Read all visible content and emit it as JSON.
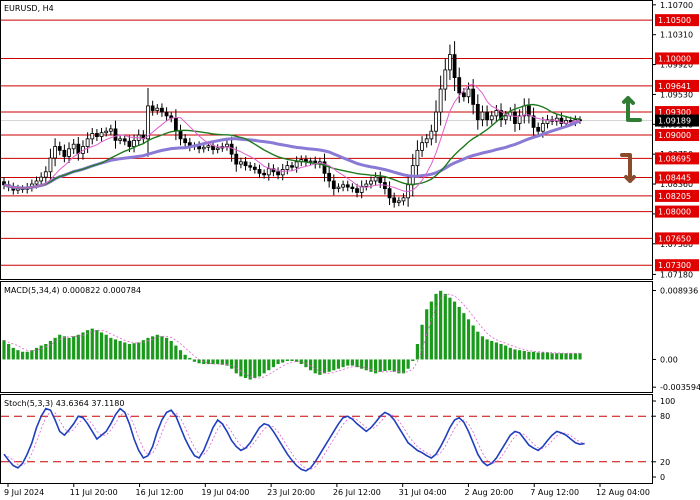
{
  "chart_data": [
    {
      "type": "candlestick",
      "title": "EURUSD, H4",
      "y_ticks": [
        "1.10700",
        "1.10310",
        "1.09920",
        "1.09530",
        "1.09140",
        "1.08750",
        "1.08360",
        "1.07970",
        "1.07580",
        "1.07180"
      ],
      "y_range": [
        1.0712,
        1.0735
      ],
      "x_tick_labels": [
        "9 Jul 2024",
        "11 Jul 20:00",
        "16 Jul 12:00",
        "19 Jul 04:00",
        "23 Jul 20:00",
        "26 Jul 12:00",
        "31 Jul 04:00",
        "2 Aug 20:00",
        "7 Aug 12:00",
        "12 Aug 04:00"
      ],
      "levels": [
        {
          "label": "1.10500",
          "value": 1.105
        },
        {
          "label": "1.10000",
          "value": 1.1
        },
        {
          "label": "1.09641",
          "value": 1.09641
        },
        {
          "label": "1.09300",
          "value": 1.093
        },
        {
          "label": "1.09000",
          "value": 1.09
        },
        {
          "label": "1.08695",
          "value": 1.08695
        },
        {
          "label": "1.08445",
          "value": 1.08445
        },
        {
          "label": "1.08205",
          "value": 1.08205
        },
        {
          "label": "1.08000",
          "value": 1.08
        },
        {
          "label": "1.07650",
          "value": 1.0765
        },
        {
          "label": "1.07300",
          "value": 1.073
        }
      ],
      "current_price": {
        "label": "1.09189",
        "value": 1.09189
      },
      "series_close": [
        1.0835,
        1.0832,
        1.0828,
        1.083,
        1.0829,
        1.0832,
        1.0836,
        1.084,
        1.0845,
        1.0852,
        1.087,
        1.0885,
        1.088,
        1.0872,
        1.0882,
        1.0888,
        1.0876,
        1.0885,
        1.0895,
        1.0902,
        1.0898,
        1.0903,
        1.0905,
        1.0908,
        1.0893,
        1.0895,
        1.0892,
        1.0885,
        1.0893,
        1.09,
        1.0895,
        1.0938,
        1.0932,
        1.0935,
        1.093,
        1.0925,
        1.0922,
        1.0905,
        1.0895,
        1.089,
        1.0885,
        1.0886,
        1.0882,
        1.0884,
        1.0886,
        1.0881,
        1.0883,
        1.0885,
        1.0888,
        1.0875,
        1.0862,
        1.0865,
        1.086,
        1.0858,
        1.0855,
        1.085,
        1.0848,
        1.0856,
        1.0852,
        1.0848,
        1.0855,
        1.086,
        1.0858,
        1.0865,
        1.0868,
        1.0865,
        1.0866,
        1.0862,
        1.0865,
        1.085,
        1.084,
        1.083,
        1.0832,
        1.0835,
        1.0832,
        1.083,
        1.0825,
        1.0833,
        1.0836,
        1.084,
        1.0845,
        1.0838,
        1.083,
        1.0818,
        1.0812,
        1.0814,
        1.0818,
        1.0835,
        1.086,
        1.088,
        1.089,
        1.0895,
        1.0905,
        1.093,
        1.096,
        1.0985,
        1.1005,
        1.0975,
        1.0955,
        1.095,
        1.096,
        1.094,
        1.092,
        1.093,
        1.092,
        1.0925,
        1.0932,
        1.092,
        1.0925,
        1.093,
        1.0915,
        1.0925,
        1.0938,
        1.0925,
        1.091,
        1.0905,
        1.0915,
        1.092,
        1.0918,
        1.0922,
        1.0915,
        1.0919,
        1.0917,
        1.092,
        1.0919
      ],
      "ma_fast_name": "MA (pink)",
      "ma_mid_name": "MA (green)",
      "ma_slow_name": "MA (purple)",
      "annotations": [
        "arrow-up (green)",
        "arrow-down (brown)"
      ]
    },
    {
      "type": "bar",
      "title": "MACD(5,34,4) 0.000822 0.000784",
      "y_ticks": [
        "0.008936",
        "0.00",
        "-0.003594"
      ],
      "y_range": [
        -0.003594,
        0.008936
      ],
      "hist_values": [
        0.0025,
        0.002,
        0.0015,
        0.0012,
        0.001,
        0.001,
        0.0012,
        0.0015,
        0.0018,
        0.002,
        0.0024,
        0.0028,
        0.0032,
        0.003,
        0.0028,
        0.003,
        0.0032,
        0.0035,
        0.0038,
        0.004,
        0.0038,
        0.0035,
        0.0032,
        0.0028,
        0.0026,
        0.0024,
        0.0022,
        0.002,
        0.0021,
        0.0022,
        0.0025,
        0.0028,
        0.003,
        0.0032,
        0.003,
        0.0028,
        0.0024,
        0.0018,
        0.0012,
        0.0006,
        0.0002,
        -0.0003,
        -0.0005,
        -0.0006,
        -0.0006,
        -0.0006,
        -0.0006,
        -0.0007,
        -0.0008,
        -0.0012,
        -0.0018,
        -0.0022,
        -0.0024,
        -0.0026,
        -0.0024,
        -0.0022,
        -0.0018,
        -0.0014,
        -0.001,
        -0.0006,
        -0.0004,
        -0.0002,
        -0.0002,
        -0.0003,
        -0.0006,
        -0.001,
        -0.0014,
        -0.0018,
        -0.002,
        -0.0018,
        -0.0016,
        -0.0014,
        -0.0012,
        -0.001,
        -0.0008,
        -0.0008,
        -0.001,
        -0.0012,
        -0.0014,
        -0.0016,
        -0.0018,
        -0.0016,
        -0.0015,
        -0.0014,
        -0.0016,
        -0.0018,
        -0.0018,
        -0.0012,
        -0.0002,
        0.002,
        0.0045,
        0.0065,
        0.0075,
        0.0085,
        0.0089,
        0.0085,
        0.008,
        0.0075,
        0.0068,
        0.006,
        0.0052,
        0.0044,
        0.0036,
        0.003,
        0.0026,
        0.0024,
        0.0022,
        0.002,
        0.0018,
        0.0015,
        0.0013,
        0.0012,
        0.0011,
        0.001,
        0.001,
        0.0009,
        0.0009,
        0.0009,
        0.0008,
        0.0008,
        0.0008,
        0.0008,
        0.0008,
        0.0008,
        0.0008
      ]
    },
    {
      "type": "line",
      "title": "Stoch(5,3,3) 43.6364 37.1180",
      "y_ticks": [
        "100",
        "80",
        "20",
        "0"
      ],
      "y_range": [
        0,
        100
      ],
      "levels": [
        80,
        20
      ],
      "k_values": [
        30,
        22,
        15,
        12,
        18,
        30,
        45,
        65,
        80,
        90,
        88,
        75,
        60,
        55,
        62,
        70,
        80,
        78,
        70,
        60,
        50,
        55,
        60,
        70,
        82,
        90,
        85,
        70,
        50,
        35,
        25,
        28,
        40,
        60,
        75,
        85,
        88,
        80,
        65,
        50,
        38,
        28,
        25,
        35,
        50,
        65,
        75,
        70,
        60,
        48,
        40,
        35,
        38,
        45,
        55,
        65,
        70,
        68,
        60,
        50,
        40,
        30,
        22,
        15,
        10,
        8,
        12,
        20,
        30,
        40,
        50,
        60,
        70,
        78,
        80,
        76,
        70,
        65,
        60,
        65,
        72,
        80,
        85,
        82,
        75,
        65,
        55,
        45,
        40,
        35,
        32,
        28,
        25,
        30,
        40,
        52,
        65,
        75,
        78,
        72,
        60,
        45,
        30,
        20,
        15,
        18,
        25,
        35,
        45,
        55,
        60,
        58,
        50,
        42,
        38,
        35,
        40,
        48,
        55,
        60,
        58,
        55,
        50,
        45,
        43,
        44
      ]
    }
  ]
}
